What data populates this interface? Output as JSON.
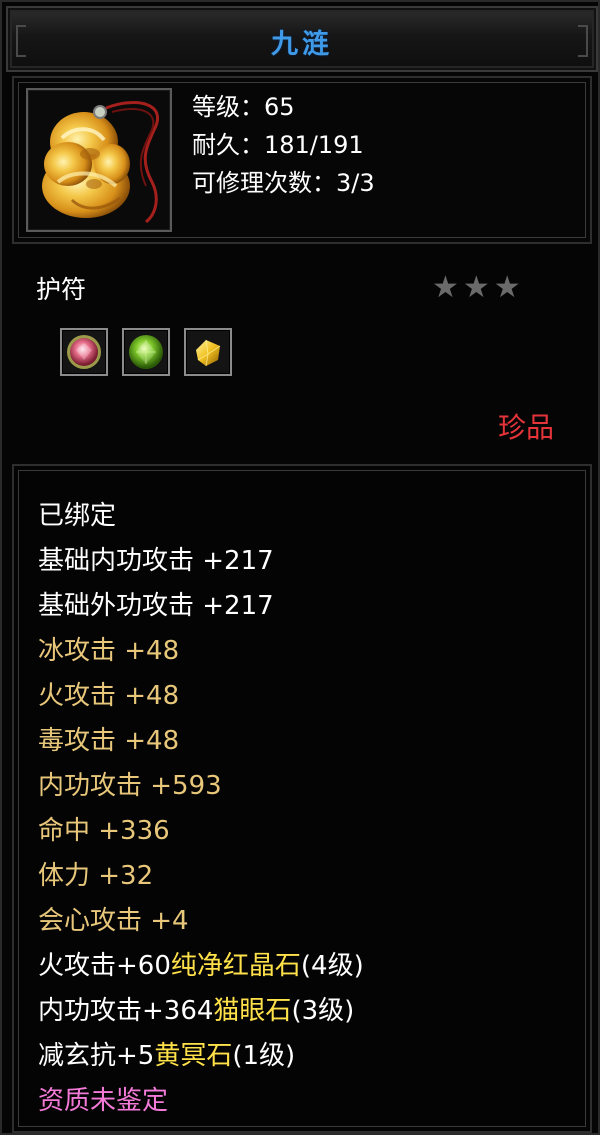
{
  "title": "九涟",
  "stats": {
    "level": "等级：65",
    "durability": "耐久：181/191",
    "repair_count": "可修理次数：3/3"
  },
  "item_type": "护符",
  "stars": "★★★",
  "rarity": "珍品",
  "gems": [
    "pink-round-gem-icon",
    "green-round-gem-icon",
    "yellow-crystal-gem-icon"
  ],
  "attributes": {
    "bound": "已绑定",
    "base_internal_attack": "基础内功攻击  +217",
    "base_external_attack": "基础外功攻击  +217",
    "ice_attack": "冰攻击  +48",
    "fire_attack": "火攻击  +48",
    "poison_attack": "毒攻击  +48",
    "internal_attack": "内功攻击  +593",
    "accuracy": "命中  +336",
    "stamina": "体力  +32",
    "critical_attack": "会心攻击  +4",
    "gem1_prefix": "火攻击+60",
    "gem1_name": "纯净红晶石",
    "gem1_level": "(4级)",
    "gem2_prefix": "内功攻击+364",
    "gem2_name": "猫眼石",
    "gem2_level": "(3级)",
    "gem3_prefix": "减玄抗+5",
    "gem3_name": "黄冥石",
    "gem3_level": "(1级)",
    "quality": "资质未鉴定"
  },
  "colors": {
    "title": "#3f9ae8",
    "rarity": "#e3343a",
    "gold_attr": "#e8c77b",
    "gem_name": "#ffe14a",
    "quality": "#f47ad8"
  }
}
